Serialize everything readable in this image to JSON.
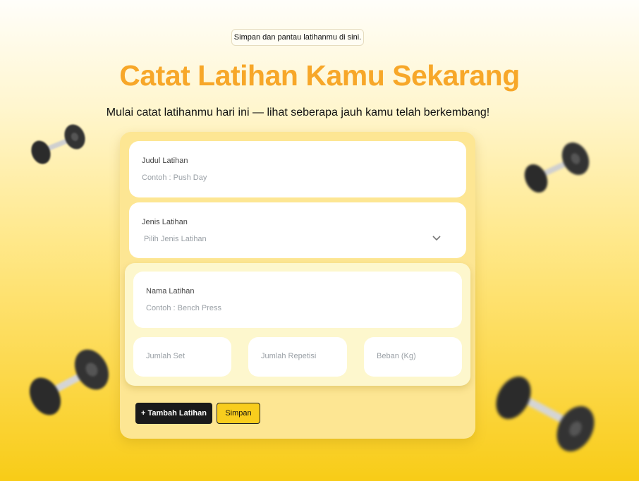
{
  "tagline": "Simpan dan pantau latihanmu di sini.",
  "title": "Catat Latihan Kamu Sekarang",
  "subtitle": "Mulai catat latihanmu hari ini — lihat seberapa jauh kamu telah berkembang!",
  "form": {
    "judul_label": "Judul Latihan",
    "judul_placeholder": "Contoh : Push Day",
    "jenis_label": "Jenis Latihan",
    "jenis_selected": "Pilih Jenis Latihan",
    "exercise": {
      "nama_label": "Nama Latihan",
      "nama_placeholder": "Contoh : Bench Press",
      "set_placeholder": "Jumlah Set",
      "rep_placeholder": "Jumlah Repetisi",
      "beban_placeholder": "Beban (Kg)"
    },
    "add_button": "+ Tambah Latihan",
    "save_button": "Simpan"
  },
  "colors": {
    "title": "#f7a729",
    "card": "#fde693",
    "button_dark": "#1a1a1a",
    "button_yellow": "#f8cd1d"
  },
  "icons": [
    "dumbbell-icon",
    "chevron-down-icon"
  ]
}
